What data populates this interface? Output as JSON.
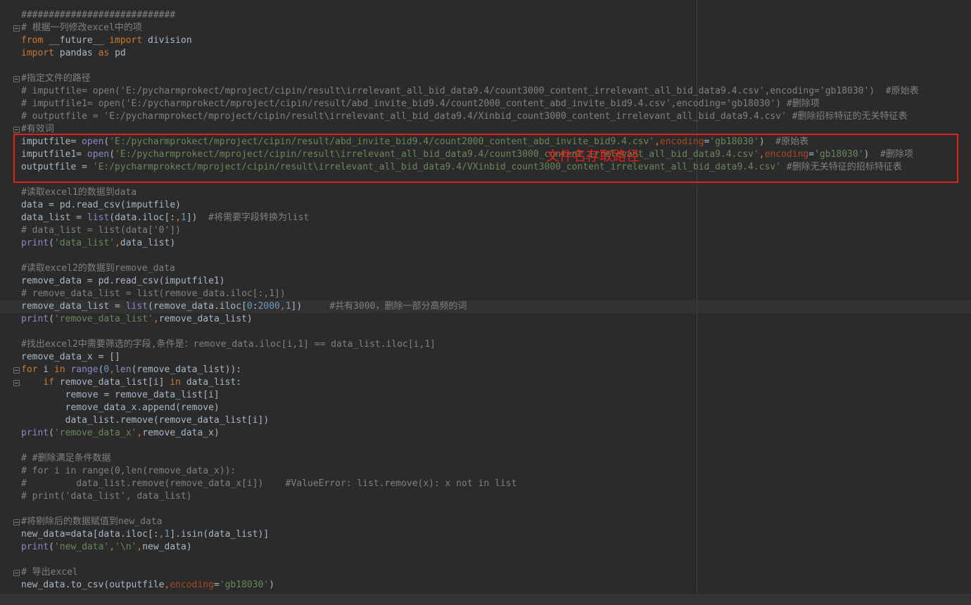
{
  "editor": {
    "lines": [
      "############################",
      "# 根据一列修改excel中的项",
      "from __future__ import division",
      "import pandas as pd",
      "",
      "#指定文件的路径",
      "# imputfile= open('E:/pycharmprokect/mproject/cipin/result\\irrelevant_all_bid_data9.4/count3000_content_irrelevant_all_bid_data9.4.csv',encoding='gb18030')  #原始表",
      "# imputfile1= open('E:/pycharmprokect/mproject/cipin/result/abd_invite_bid9.4/count2000_content_abd_invite_bid9.4.csv',encoding='gb18030') #删除项",
      "# outputfile = 'E:/pycharmprokect/mproject/cipin/result\\irrelevant_all_bid_data9.4/Xinbid_count3000_content_irrelevant_all_bid_data9.4.csv' #删除招标特征的无关特征表",
      "#有效词",
      "imputfile= open('E:/pycharmprokect/mproject/cipin/result/abd_invite_bid9.4/count2000_content_abd_invite_bid9.4.csv',encoding='gb18030')  #原始表",
      "imputfile1= open('E:/pycharmprokect/mproject/cipin/result\\irrelevant_all_bid_data9.4/count3000_content_irrelevant_all_bid_data9.4.csv',encoding='gb18030')  #删除项",
      "outputfile = 'E:/pycharmprokect/mproject/cipin/result\\irrelevant_all_bid_data9.4/VXinbid_count3000_content_irrelevant_all_bid_data9.4.csv' #删除无关特征的招标特征表",
      "",
      "#读取excel1的数据到data",
      "data = pd.read_csv(imputfile)",
      "data_list = list(data.iloc[:,1])  #将需要字段转换为list",
      "# data_list = list(data['0'])",
      "print('data_list',data_list)",
      "",
      "#读取excel2的数据到remove_data",
      "remove_data = pd.read_csv(imputfile1)",
      "# remove_data_list = list(remove_data.iloc[:,1])",
      "remove_data_list = list(remove_data.iloc[0:2000,1])     #共有3000，删除一部分高频的词",
      "print('remove_data_list',remove_data_list)",
      "",
      "#找出excel2中需要筛选的字段,条件是：remove_data.iloc[i,1] == data_list.iloc[i,1]",
      "remove_data_x = []",
      "for i in range(0,len(remove_data_list)):",
      "    if remove_data_list[i] in data_list:",
      "        remove = remove_data_list[i]",
      "        remove_data_x.append(remove)",
      "        data_list.remove(remove_data_list[i])",
      "print('remove_data_x',remove_data_x)",
      "",
      "# #删除满足条件数据",
      "# for i in range(0,len(remove_data_x)):",
      "#         data_list.remove(remove_data_x[i])    #ValueError: list.remove(x): x not in list",
      "# print('data_list', data_list)",
      "",
      "#将剔除后的数据赋值到new_data",
      "new_data=data[data.iloc[:,1].isin(data_list)]",
      "print('new_data','\\n',new_data)",
      "",
      "# 导出excel",
      "new_data.to_csv(outputfile,encoding='gb18030')"
    ],
    "fold_marker_lines": [
      1,
      5,
      9,
      28,
      29,
      40,
      44
    ],
    "annotation": "文件名存取路径",
    "colors": {
      "background": "#2b2b2b",
      "default_text": "#a9b7c6",
      "keyword": "#cc7832",
      "string": "#6a8759",
      "comment": "#808080",
      "number": "#6897bb",
      "builtin": "#8888c6",
      "kwarg": "#aa4926",
      "highlight_box": "#e0201a"
    }
  }
}
